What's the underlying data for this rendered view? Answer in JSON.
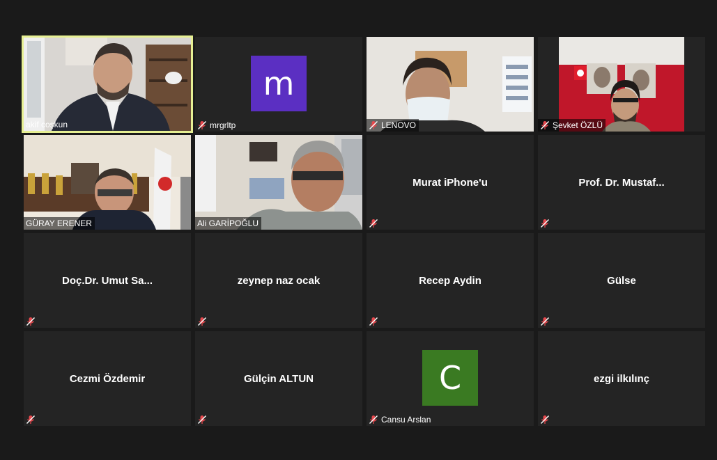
{
  "participants": [
    {
      "name": "akif coşkun",
      "type": "video",
      "active": true
    },
    {
      "name": "mrgrltp",
      "type": "avatar",
      "initial": "m",
      "avatar_color": "#5b2fc2"
    },
    {
      "name": "LENOVO",
      "type": "video"
    },
    {
      "name": "Şevket ÖZLÜ",
      "type": "video"
    },
    {
      "name": "GÜRAY ERENER",
      "type": "video"
    },
    {
      "name": "Ali GARİPOĞLU",
      "type": "video"
    },
    {
      "name": "Murat iPhone'u",
      "type": "name"
    },
    {
      "name": "Prof. Dr. Mustaf...",
      "type": "name"
    },
    {
      "name": "Doç.Dr. Umut Sa...",
      "type": "name"
    },
    {
      "name": "zeynep naz ocak",
      "type": "name"
    },
    {
      "name": "Recep Aydin",
      "type": "name"
    },
    {
      "name": "Gülse",
      "type": "name"
    },
    {
      "name": "Cezmi Özdemir",
      "type": "name"
    },
    {
      "name": "Gülçin ALTUN",
      "type": "name"
    },
    {
      "name": "Cansu Arslan",
      "type": "avatar",
      "initial": "C",
      "avatar_color": "#3a7a22"
    },
    {
      "name": "ezgi ilkılınç",
      "type": "name"
    }
  ],
  "colors": {
    "background": "#1a1a1a",
    "tile": "#242424",
    "active_border": "#e6ef93",
    "muted_icon": "#e5484d"
  },
  "icons": {
    "muted": "muted-microphone-icon"
  }
}
